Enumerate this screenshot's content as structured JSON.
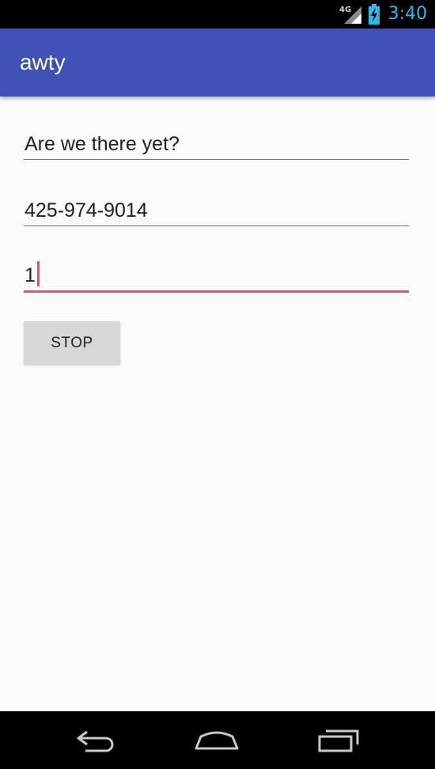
{
  "status_bar": {
    "network_label": "4G",
    "network_icon": "signal-icon",
    "battery_icon": "battery-charging-icon",
    "time": "3:40",
    "time_color": "#33b5e5"
  },
  "app_bar": {
    "title": "awty",
    "color": "#3f51b5"
  },
  "form": {
    "message_value": "Are we there yet?",
    "phone_value": "425-974-9014",
    "interval_value": "1",
    "focus_color": "#e84c85"
  },
  "button": {
    "stop_label": "STOP"
  },
  "nav_bar": {
    "back_icon": "back-icon",
    "home_icon": "home-icon",
    "recents_icon": "recents-icon"
  }
}
